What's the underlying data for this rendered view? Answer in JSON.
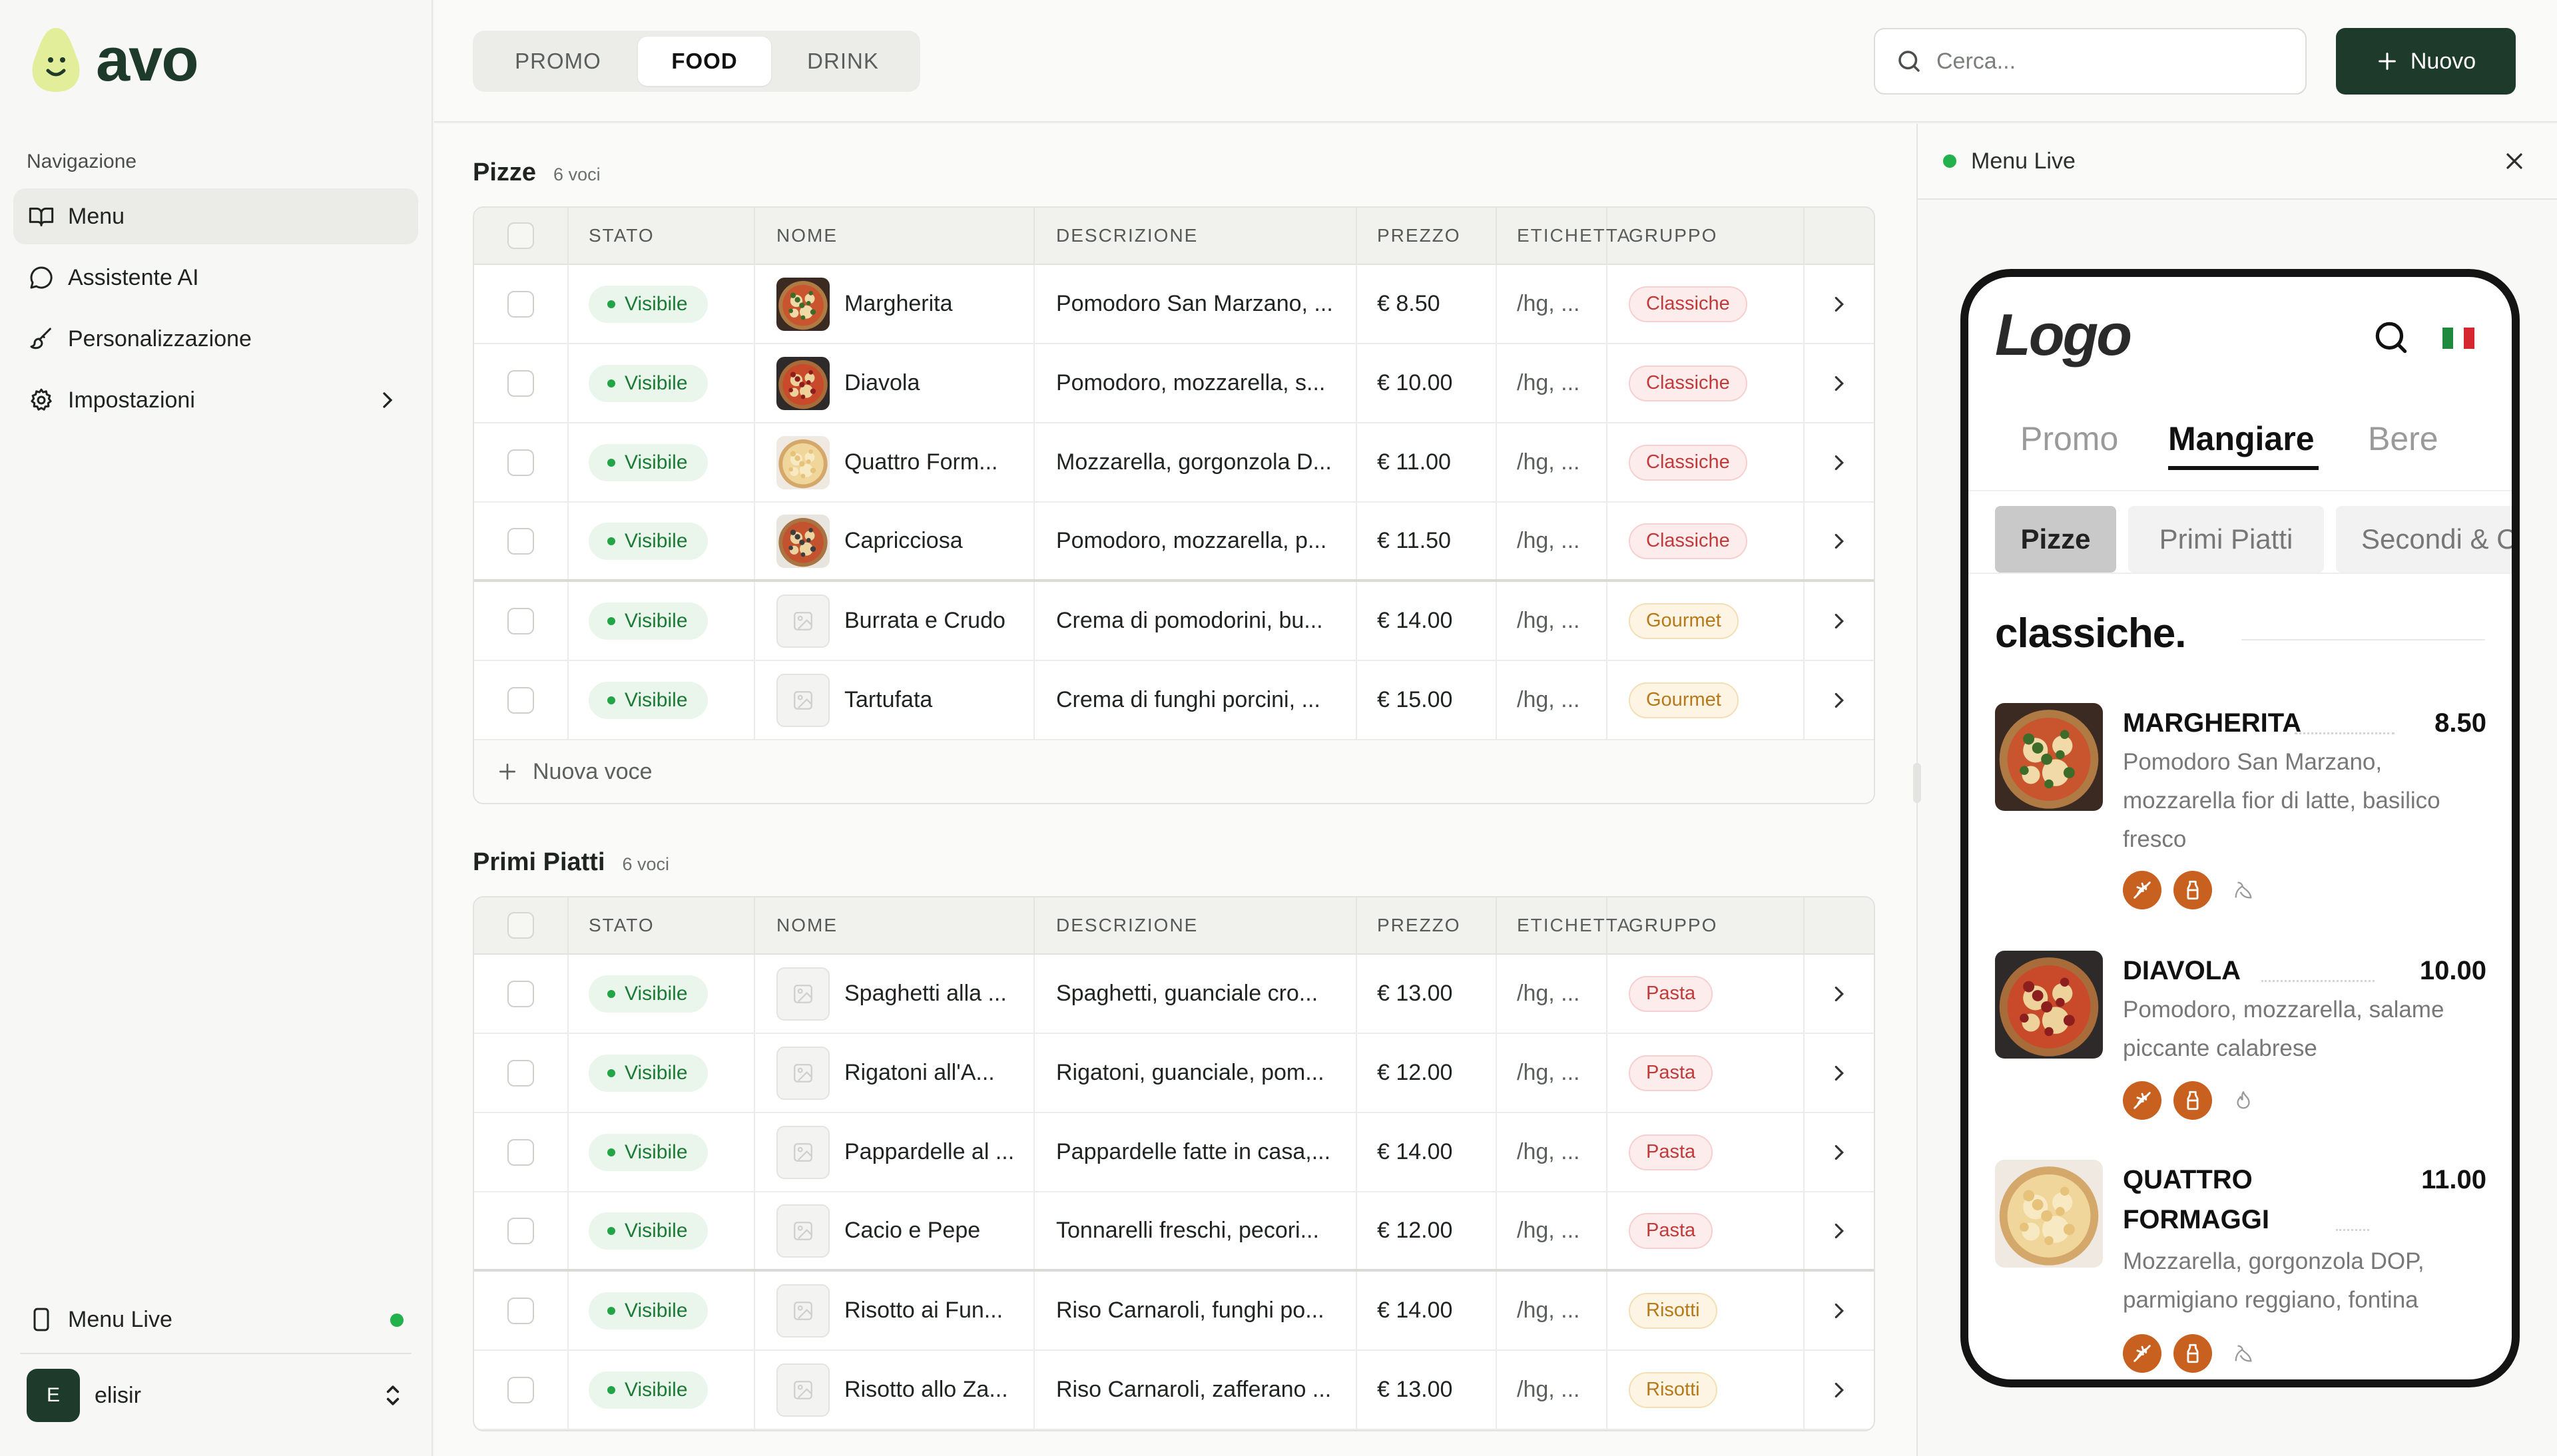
{
  "brand": {
    "name": "avo",
    "accent": "#1d3a2a",
    "mark_color": "#e3ee9a"
  },
  "sidebar": {
    "heading": "Navigazione",
    "items": [
      {
        "label": "Menu",
        "icon": "book-open-icon",
        "active": true
      },
      {
        "label": "Assistente AI",
        "icon": "chat-bubble-icon"
      },
      {
        "label": "Personalizzazione",
        "icon": "paintbrush-icon"
      },
      {
        "label": "Impostazioni",
        "icon": "gear-icon",
        "has_submenu": true
      }
    ],
    "live": {
      "label": "Menu Live",
      "icon": "smartphone-icon",
      "status_color": "#22b14c"
    },
    "user": {
      "initial": "E",
      "name": "elisir"
    }
  },
  "topbar": {
    "tabs": [
      "PROMO",
      "FOOD",
      "DRINK"
    ],
    "active_tab": "FOOD",
    "search_placeholder": "Cerca...",
    "new_button": "Nuovo"
  },
  "table_columns": [
    "STATO",
    "NOME",
    "DESCRIZIONE",
    "PREZZO",
    "ETICHETTA",
    "GRUPPO"
  ],
  "sections": [
    {
      "title": "Pizze",
      "count": "6 voci",
      "add_label": "Nuova voce",
      "rows": [
        {
          "status": "Visibile",
          "name": "Margherita",
          "description": "Pomodoro San Marzano, ...",
          "price": "€ 8.50",
          "label": "/hg, ...",
          "group": "Classiche",
          "group_color": "red",
          "image": "pizza-margherita"
        },
        {
          "status": "Visibile",
          "name": "Diavola",
          "description": "Pomodoro, mozzarella, s...",
          "price": "€ 10.00",
          "label": "/hg, ...",
          "group": "Classiche",
          "group_color": "red",
          "image": "pizza-diavola"
        },
        {
          "status": "Visibile",
          "name": "Quattro Form...",
          "description": "Mozzarella, gorgonzola D...",
          "price": "€ 11.00",
          "label": "/hg, ...",
          "group": "Classiche",
          "group_color": "red",
          "image": "pizza-quattro-formaggi"
        },
        {
          "status": "Visibile",
          "name": "Capricciosa",
          "description": "Pomodoro, mozzarella, p...",
          "price": "€ 11.50",
          "label": "/hg, ...",
          "group": "Classiche",
          "group_color": "red",
          "image": "pizza-capricciosa"
        },
        {
          "status": "Visibile",
          "name": "Burrata e Crudo",
          "description": "Crema di pomodorini, bu...",
          "price": "€ 14.00",
          "label": "/hg, ...",
          "group": "Gourmet",
          "group_color": "amber",
          "image": ""
        },
        {
          "status": "Visibile",
          "name": "Tartufata",
          "description": "Crema di funghi porcini, ...",
          "price": "€ 15.00",
          "label": "/hg, ...",
          "group": "Gourmet",
          "group_color": "amber",
          "image": ""
        }
      ]
    },
    {
      "title": "Primi Piatti",
      "count": "6 voci",
      "rows": [
        {
          "status": "Visibile",
          "name": "Spaghetti alla ...",
          "description": "Spaghetti, guanciale cro...",
          "price": "€ 13.00",
          "label": "/hg, ...",
          "group": "Pasta",
          "group_color": "red",
          "image": ""
        },
        {
          "status": "Visibile",
          "name": "Rigatoni all'A...",
          "description": "Rigatoni, guanciale, pom...",
          "price": "€ 12.00",
          "label": "/hg, ...",
          "group": "Pasta",
          "group_color": "red",
          "image": ""
        },
        {
          "status": "Visibile",
          "name": "Pappardelle al ...",
          "description": "Pappardelle fatte in casa,...",
          "price": "€ 14.00",
          "label": "/hg, ...",
          "group": "Pasta",
          "group_color": "red",
          "image": ""
        },
        {
          "status": "Visibile",
          "name": "Cacio e Pepe",
          "description": "Tonnarelli freschi, pecori...",
          "price": "€ 12.00",
          "label": "/hg, ...",
          "group": "Pasta",
          "group_color": "red",
          "image": ""
        },
        {
          "status": "Visibile",
          "name": "Risotto ai Fun...",
          "description": "Riso Carnaroli, funghi po...",
          "price": "€ 14.00",
          "label": "/hg, ...",
          "group": "Risotti",
          "group_color": "amber",
          "image": ""
        },
        {
          "status": "Visibile",
          "name": "Risotto allo Za...",
          "description": "Riso Carnaroli, zafferano ...",
          "price": "€ 13.00",
          "label": "/hg, ...",
          "group": "Risotti",
          "group_color": "amber",
          "image": ""
        }
      ]
    }
  ],
  "preview": {
    "title": "Menu Live",
    "logo": "Logo",
    "tabs": [
      "Promo",
      "Mangiare",
      "Bere"
    ],
    "active_tab": "Mangiare",
    "categories": [
      "Pizze",
      "Primi Piatti",
      "Secondi & C"
    ],
    "active_category": "Pizze",
    "group_heading": "classiche.",
    "allergen_color": "#c8611f",
    "items": [
      {
        "name": "MARGHERITA",
        "price": "8.50",
        "description": [
          "Pomodoro San Marzano,",
          "mozzarella fior di latte, basilico",
          "fresco"
        ],
        "image": "pizza-margherita",
        "allergens": [
          "gluten-icon",
          "milk-icon",
          "vegetarian-icon"
        ]
      },
      {
        "name": "DIAVOLA",
        "price": "10.00",
        "description": [
          "Pomodoro, mozzarella, salame",
          "piccante calabrese"
        ],
        "image": "pizza-diavola",
        "allergens": [
          "gluten-icon",
          "milk-icon",
          "spicy-icon"
        ]
      },
      {
        "name_lines": [
          "QUATTRO",
          "FORMAGGI"
        ],
        "price": "11.00",
        "description": [
          "Mozzarella, gorgonzola DOP,",
          "parmigiano reggiano, fontina"
        ],
        "image": "pizza-quattro-formaggi",
        "allergens": [
          "gluten-icon",
          "milk-icon",
          "vegetarian-icon"
        ]
      }
    ]
  }
}
